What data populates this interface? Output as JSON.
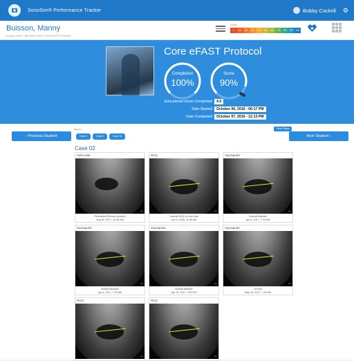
{
  "header": {
    "app_title": "SonoSim® Performance Tracker",
    "user_name": "Bobby Cockrill"
  },
  "student": {
    "name": "Buisson, Manny",
    "breadcrumb": "Group Level > Student Level > Core eFAST Protocol"
  },
  "score_legend": {
    "label": "Score",
    "values": [
      "0",
      "10",
      "20",
      "30",
      "40",
      "50",
      "60",
      "70",
      "80",
      "90",
      "100"
    ],
    "colors": [
      "#e84b2a",
      "#ee612b",
      "#f07a2b",
      "#f4942d",
      "#f6ad30",
      "#d6b536",
      "#9cbf40",
      "#5fb758",
      "#35a88b",
      "#2c95c3",
      "#1f78c8"
    ]
  },
  "protocol": {
    "title": "Core eFAST Protocol",
    "completion_label": "Completion",
    "completion_value": "100%",
    "completion_fraction": 1.0,
    "score_label": "Score",
    "score_value": "90%",
    "score_fraction": 0.9,
    "edu_hours_label": "Educational Hours Completed:",
    "edu_hours_value": "4.0",
    "date_started_label": "Date Started:",
    "date_started_value": "October 06, 2016 - 06:17 PM",
    "date_completed_label": "Date Completed:",
    "date_completed_value": "October 07, 2016 - 12:13 PM"
  },
  "nav": {
    "prev_label": "‹  Previous Student",
    "next_label": "Next Student  ›",
    "filter_label": "Filter by:",
    "chips": [
      "Case 2",
      "Case 3",
      "Case 16"
    ],
    "clear_label": "Clear Filters"
  },
  "case": {
    "title": "Case 02",
    "cards": [
      {
        "category": "Subcostal",
        "caption_line1": "Pericardial Effusion present",
        "caption_line2": "Aug 30, 2017, 10:45 AM"
      },
      {
        "category": "RUQ",
        "caption_line1": "Normal RUQ no free fluid",
        "caption_line2": "Jan 5, 2018, 11:56 AM"
      },
      {
        "category": "Suprapubic",
        "caption_line1": "Normal Bladder",
        "caption_line2": "Apr 6, 2017, 7:33 AM"
      },
      {
        "category": "Suprapubic",
        "caption_line1": "Normal Bladder",
        "caption_line2": "Apr 6, 2017, 7:33 AM"
      },
      {
        "category": "Suprapubic",
        "caption_line1": "Normal Bladder",
        "caption_line2": "Apr 24, 2017, 3:03 PM"
      },
      {
        "category": "Suprapubic",
        "caption_line1": "normal",
        "caption_line2": "May 16, 2017, 7:26 AM"
      },
      {
        "category": "RUQ",
        "caption_line1": "",
        "caption_line2": ""
      },
      {
        "category": "RUQ",
        "caption_line1": "",
        "caption_line2": ""
      }
    ]
  }
}
